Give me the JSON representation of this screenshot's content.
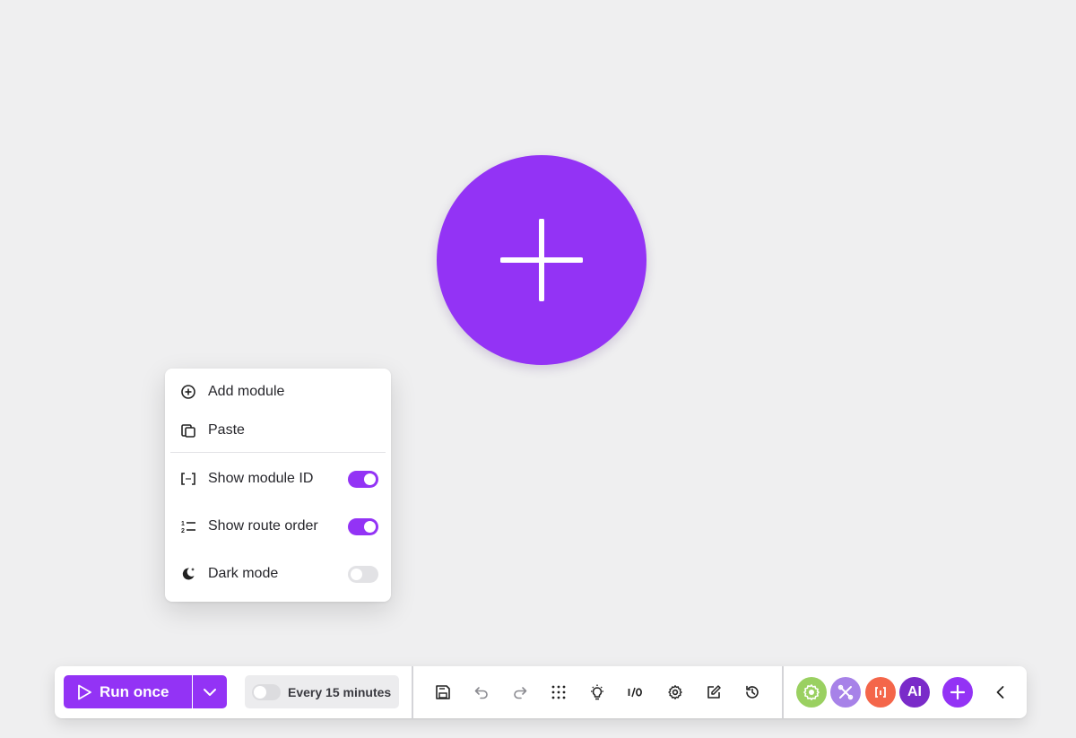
{
  "canvas": {
    "add_icon": "plus-icon",
    "accent": "#9333f5"
  },
  "context_menu": {
    "items": [
      {
        "label": "Add module",
        "icon": "plus-circle-icon"
      },
      {
        "label": "Paste",
        "icon": "paste-icon"
      },
      {
        "label": "Show module ID",
        "icon": "module-id-icon",
        "toggle": true
      },
      {
        "label": "Show route order",
        "icon": "route-order-icon",
        "toggle": true
      },
      {
        "label": "Dark mode",
        "icon": "moon-icon",
        "toggle": false
      }
    ]
  },
  "toolbar": {
    "run_label": "Run once",
    "schedule_label": "Every 15 minutes",
    "schedule_enabled": false,
    "io_label": "I/O",
    "tools": [
      "save-icon",
      "undo-icon",
      "redo-icon",
      "grid-dots-icon",
      "bulb-icon",
      "io-icon",
      "gear-icon",
      "notes-icon",
      "history-icon"
    ],
    "apps": [
      {
        "name": "flow-control",
        "color": "#9ad061"
      },
      {
        "name": "tools",
        "color": "#a782e8"
      },
      {
        "name": "json",
        "color": "#f4664a"
      },
      {
        "name": "ai",
        "label": "AI",
        "color": "#7a2bc9"
      }
    ],
    "add_app_color": "#9333f5"
  }
}
